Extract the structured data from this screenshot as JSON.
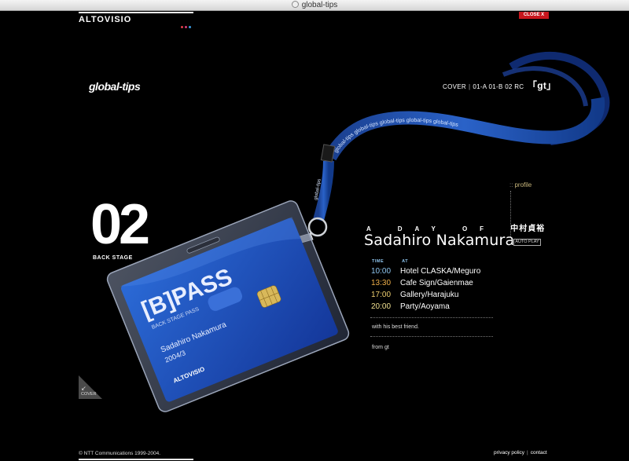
{
  "window": {
    "title": "global-tips"
  },
  "header": {
    "logo": "ALTOVISIO",
    "close_label": "CLOSE X",
    "dot_colors": [
      "#e0404a",
      "#d43a78",
      "#3a9be0"
    ]
  },
  "brand": {
    "title": "global-tips"
  },
  "breadcrumb": {
    "items": [
      "COVER",
      "01-A",
      "01-B",
      "02",
      "RC"
    ],
    "active": "「gt」"
  },
  "section": {
    "number": "02",
    "label": "BACK STAGE"
  },
  "badge": {
    "title": "[B]PASS",
    "subtitle": "BACK STAGE PASS",
    "name": "Sadahiro Nakamura",
    "date": "2004/3",
    "logo": "ALTOVISIO",
    "lanyard_text": "global-tips"
  },
  "profile": {
    "link_label": "profile",
    "day_of": "A DAY OF",
    "kanji_name": "中村貞裕",
    "name": "Sadahiro Nakamura",
    "autoplay_label": "AUTO PLAY",
    "time_header": "TIME",
    "at_header": "AT",
    "schedule": [
      {
        "time": "10:00",
        "place": "Hotel CLASKA/Meguro",
        "color": "#8fc6f0"
      },
      {
        "time": "13:30",
        "place": "Cafe Sign/Gaienmae",
        "color": "#f0b04a"
      },
      {
        "time": "17:00",
        "place": "Gallery/Harajuku",
        "color": "#f0d070"
      },
      {
        "time": "20:00",
        "place": "Party/Aoyama",
        "color": "#f0e090"
      }
    ],
    "note": "with his best friend.",
    "from": "from gt"
  },
  "cover_corner": {
    "label": "COVER"
  },
  "footer": {
    "copyright": "© NTT Communications 1999-2004.",
    "privacy": "privacy policy",
    "contact": "contact"
  },
  "colors": {
    "accent_red": "#c8161d",
    "lanyard_blue": "#1f4ea8",
    "badge_blue": "#1d4fb8"
  }
}
